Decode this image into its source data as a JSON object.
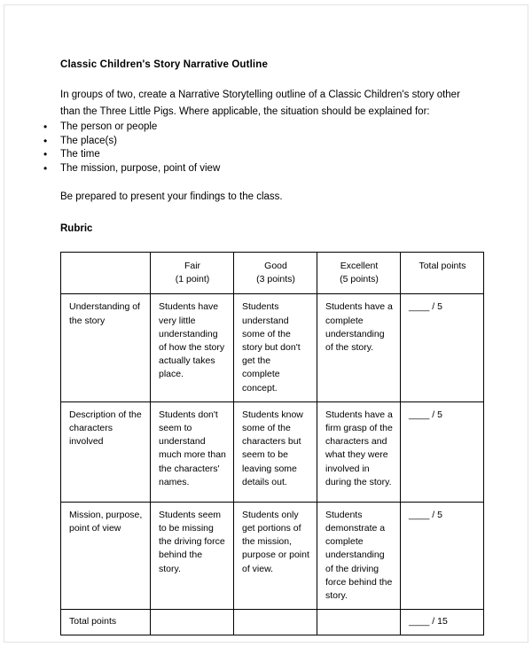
{
  "document": {
    "title": "Classic Children's Story Narrative Outline",
    "intro": "In groups of two, create a Narrative Storytelling outline of a Classic Children's story other than the Three Little Pigs. Where applicable, the situation should be explained for:",
    "bullets": [
      "The person or people",
      "The place(s)",
      "The time",
      "The mission, purpose, point of view"
    ],
    "bullet_glyph": "•",
    "closing": "Be prepared to present your findings to the class.",
    "rubric_heading": "Rubric"
  },
  "rubric": {
    "headers": [
      {
        "line1": "",
        "line2": ""
      },
      {
        "line1": "Fair",
        "line2": "(1 point)"
      },
      {
        "line1": "Good",
        "line2": "(3 points)"
      },
      {
        "line1": "Excellent",
        "line2": "(5 points)"
      },
      {
        "line1": "Total points",
        "line2": ""
      }
    ],
    "rows": [
      {
        "criterion": "Understanding of the story",
        "fair": "Students have very little understanding of how the story actually takes place.",
        "good": "Students understand some of the story but don't get the complete concept.",
        "excellent": "Students have a complete understanding of the story.",
        "points": "____ / 5"
      },
      {
        "criterion": "Description of the characters involved",
        "fair": "Students don't seem to understand much more than the characters' names.",
        "good": "Students know some of the characters but seem to be leaving some details out.",
        "excellent": "Students have a firm grasp of the characters and what they were involved in during the story.",
        "points": "____ / 5"
      },
      {
        "criterion": "Mission, purpose, point of view",
        "fair": "Students seem to be missing the driving force behind the story.",
        "good": "Students only get portions of the mission, purpose or point of view.",
        "excellent": "Students demonstrate a complete understanding of the driving force behind the story.",
        "points": "____ / 5"
      }
    ],
    "total_row": {
      "criterion": "Total points",
      "fair": "",
      "good": "",
      "excellent": "",
      "points": "____ / 15"
    }
  }
}
